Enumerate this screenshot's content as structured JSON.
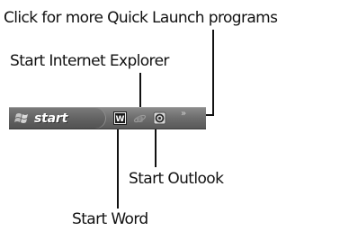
{
  "labels": {
    "more_programs": "Click for more Quick Launch programs",
    "internet_explorer": "Start Internet Explorer",
    "outlook": "Start Outlook",
    "word": "Start Word"
  },
  "taskbar": {
    "start_label": "start",
    "quick_launch": [
      {
        "icon": "word-icon",
        "glyph": "W"
      },
      {
        "icon": "internet-explorer-icon",
        "glyph": "e"
      },
      {
        "icon": "outlook-icon",
        "glyph": "O"
      }
    ],
    "more_chevron": "»"
  }
}
